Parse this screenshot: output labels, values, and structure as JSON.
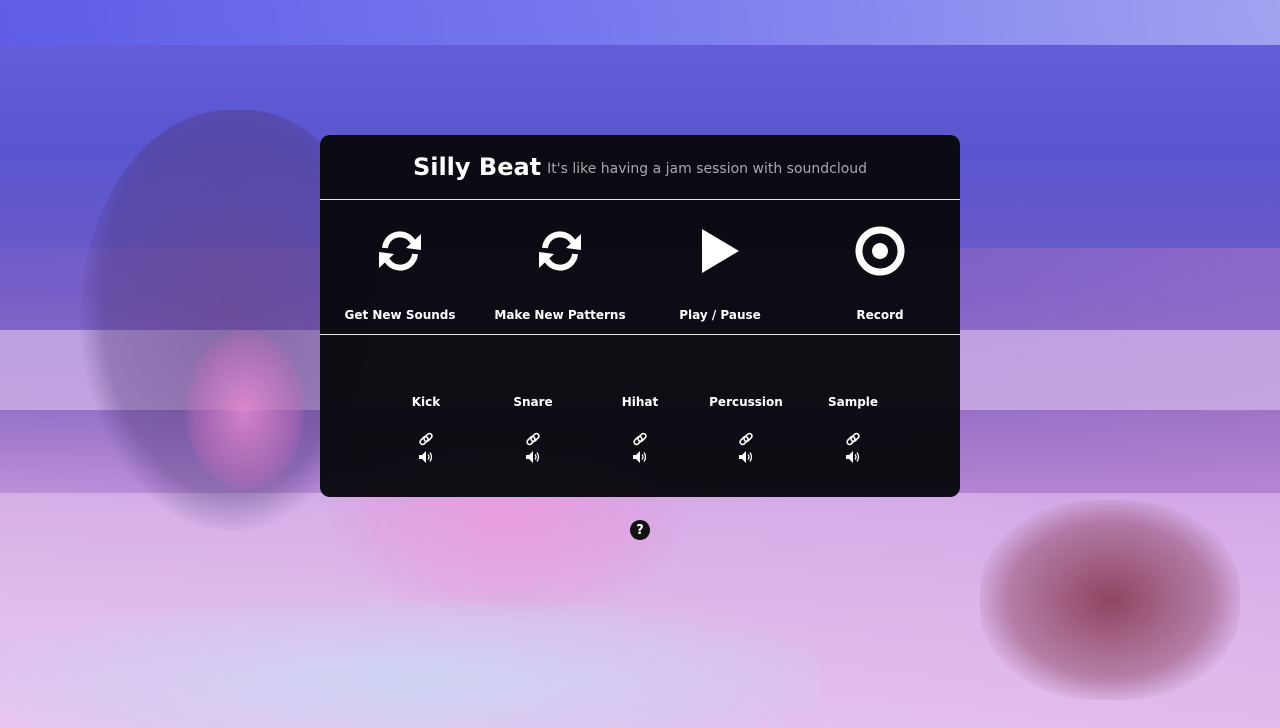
{
  "app": {
    "title": "Silly Beat",
    "subtitle": "It's like having a jam session with soundcloud"
  },
  "controls": [
    {
      "label": "Get New Sounds",
      "icon": "refresh-icon"
    },
    {
      "label": "Make New Patterns",
      "icon": "refresh-icon"
    },
    {
      "label": "Play / Pause",
      "icon": "play-icon"
    },
    {
      "label": "Record",
      "icon": "record-icon"
    }
  ],
  "tracks": [
    {
      "name": "Kick",
      "link_icon": "link-icon",
      "volume_icon": "volume-icon"
    },
    {
      "name": "Snare",
      "link_icon": "link-icon",
      "volume_icon": "volume-icon"
    },
    {
      "name": "Hihat",
      "link_icon": "link-icon",
      "volume_icon": "volume-icon"
    },
    {
      "name": "Percussion",
      "link_icon": "link-icon",
      "volume_icon": "volume-icon"
    },
    {
      "name": "Sample",
      "link_icon": "link-icon",
      "volume_icon": "volume-icon"
    }
  ],
  "help": {
    "glyph": "?",
    "icon": "help-icon"
  },
  "colors": {
    "panel_background": "#08080c",
    "text": "#ffffff",
    "subtitle": "#a8a8a8",
    "divider": "#e6e6e6"
  }
}
